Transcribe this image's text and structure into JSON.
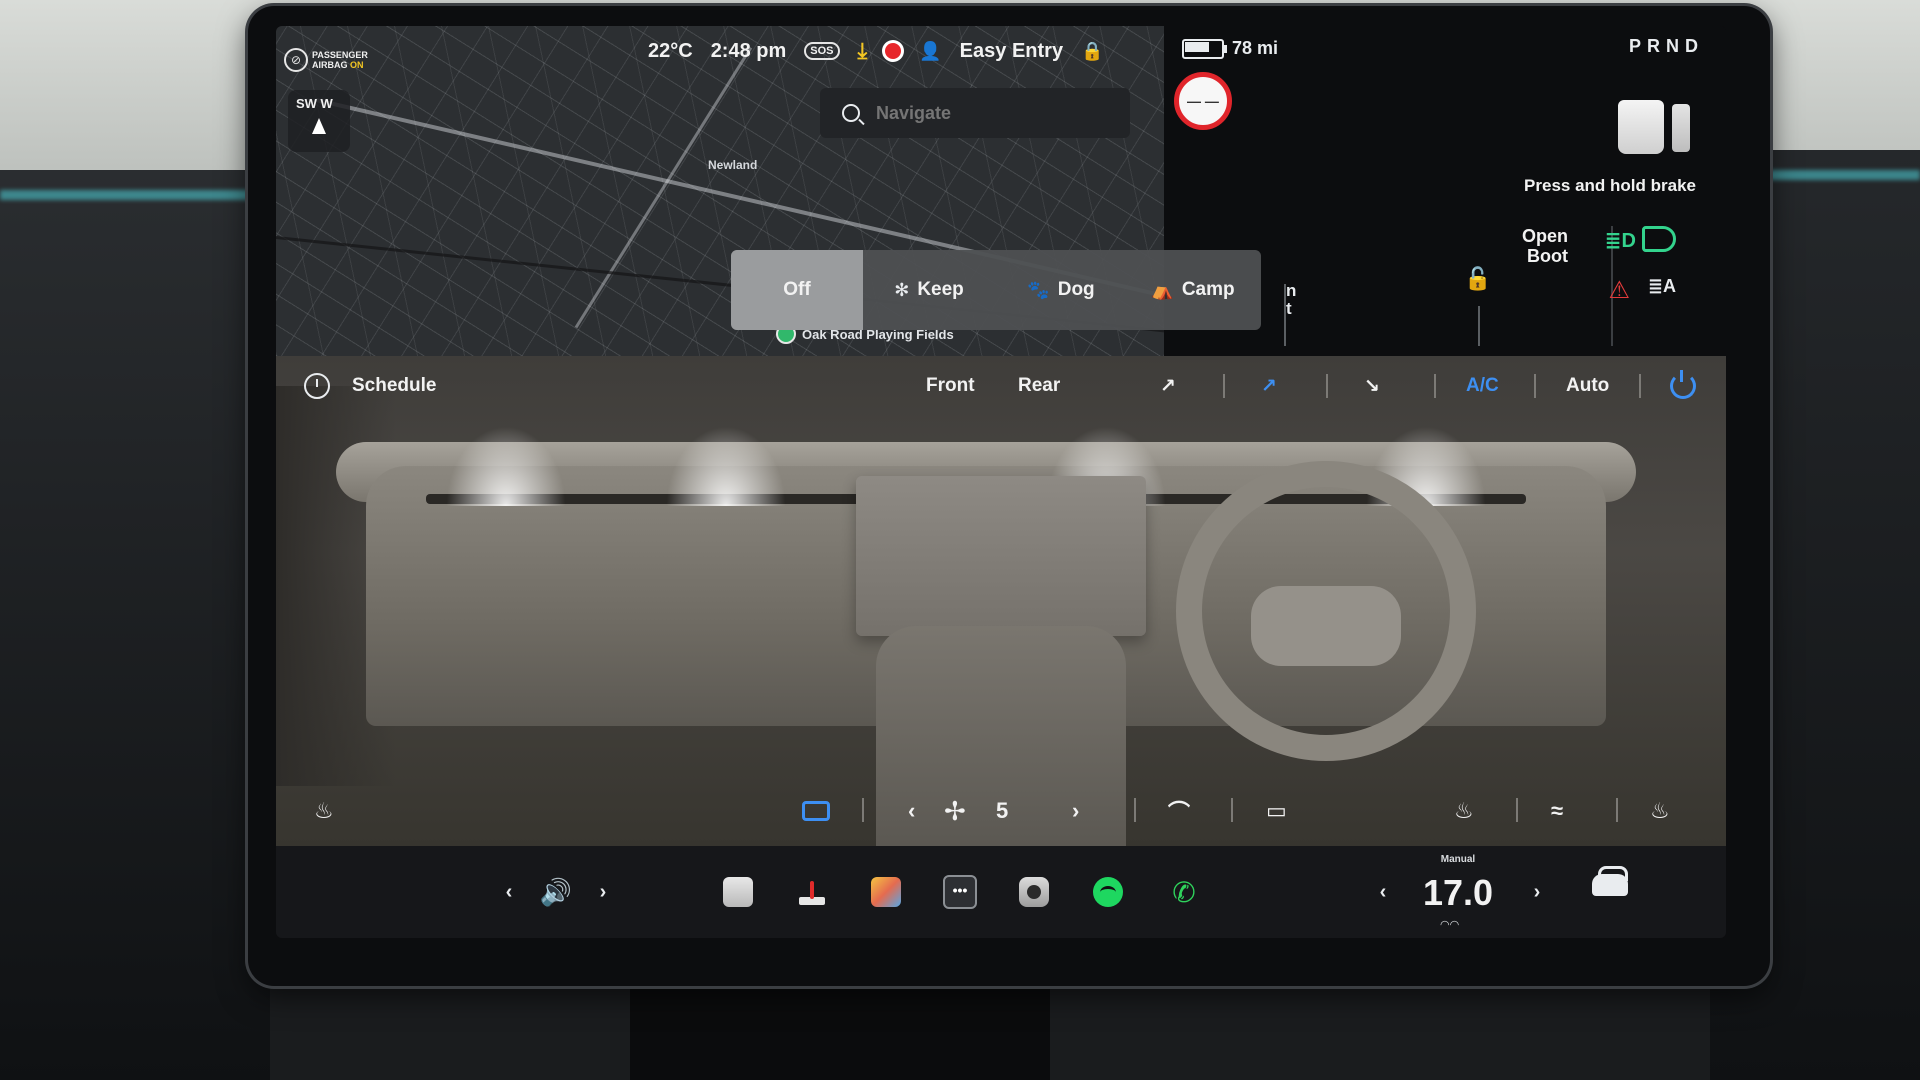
{
  "status_bar": {
    "airbag_label": "PASSENGER AIRBAG",
    "airbag_state": "ON",
    "compass": "SW W",
    "temperature": "22°C",
    "time": "2:48 pm",
    "sos": "SOS",
    "profile": "Easy Entry",
    "range": "78 mi",
    "battery_level": 0.7,
    "gear": "PRND"
  },
  "map": {
    "search_placeholder": "Navigate",
    "place_label": "Newland",
    "poi_label": "Oak Road Playing Fields"
  },
  "drive_panel": {
    "brake_message": "Press and hold brake",
    "boot_label": "Open\nBoot",
    "cut_text": "n\nt"
  },
  "climate_keeper": {
    "options": [
      "Off",
      "Keep",
      "Dog",
      "Camp"
    ],
    "selected": "Off"
  },
  "climate": {
    "schedule_label": "Schedule",
    "front_label": "Front",
    "rear_label": "Rear",
    "ac_label": "A/C",
    "auto_label": "Auto",
    "fan_speed": "5",
    "accent_color": "#3d8ff2"
  },
  "taskbar": {
    "temp_mode": "Manual",
    "temperature": "17.0"
  },
  "colors": {
    "green_status": "#33d38d",
    "warning_red": "#e23b3b"
  }
}
